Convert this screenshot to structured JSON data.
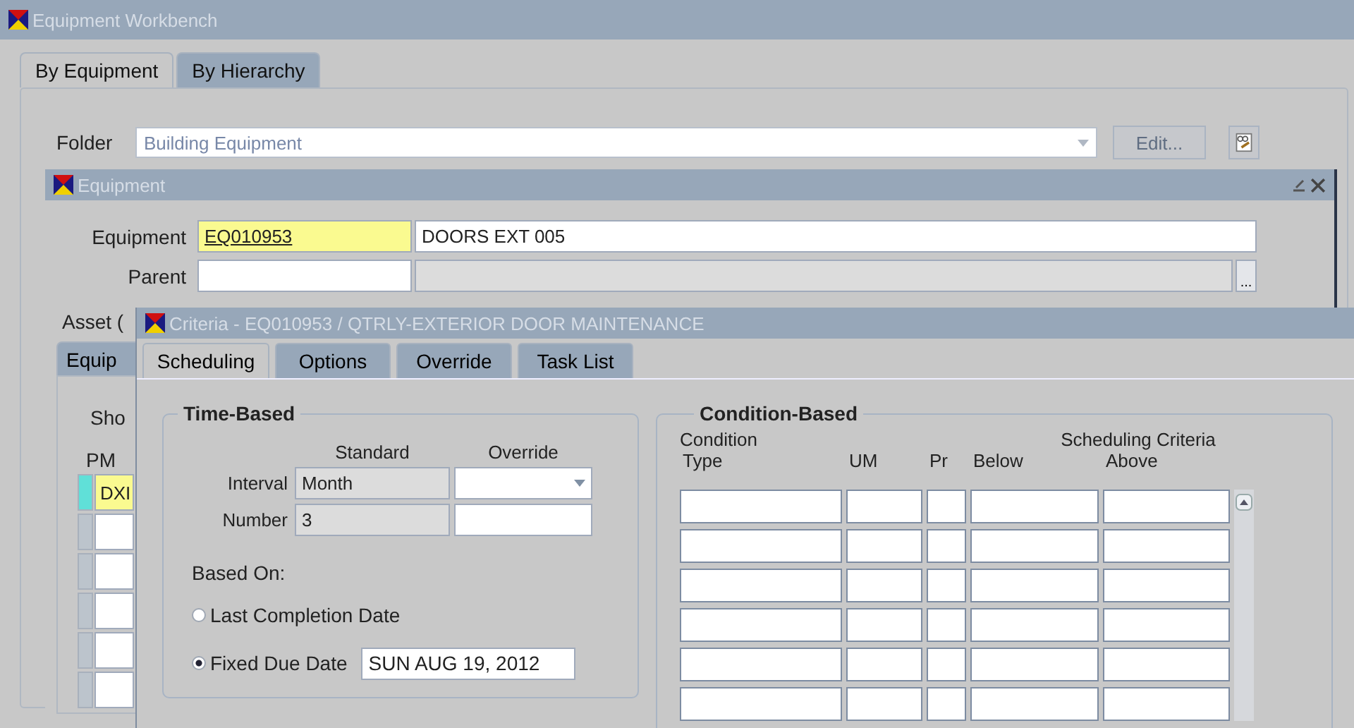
{
  "window": {
    "title": "Equipment Workbench"
  },
  "tabs": [
    {
      "label": "By Equipment",
      "selected": true
    },
    {
      "label": "By Hierarchy",
      "selected": false
    }
  ],
  "folder": {
    "label": "Folder",
    "value": "Building Equipment",
    "edit_button": "Edit..."
  },
  "equipment_window": {
    "title": "Equipment",
    "equipment_label": "Equipment",
    "equipment": "EQ010953",
    "description": "DOORS EXT 005",
    "parent_label": "Parent",
    "lookup_button": "...",
    "asset_label": "Asset (",
    "tab": "Equip",
    "show_label": "Sho",
    "pm_label": "PM",
    "pm_rows": [
      {
        "value": "DXI",
        "selected": true
      },
      {
        "selected": false
      },
      {
        "selected": false
      },
      {
        "selected": false
      },
      {
        "selected": false
      },
      {
        "selected": false
      }
    ]
  },
  "criteria_window": {
    "title": "Criteria - EQ010953 / QTRLY-EXTERIOR DOOR MAINTENANCE",
    "tabs": [
      {
        "label": "Scheduling",
        "selected": true
      },
      {
        "label": "Options",
        "selected": false
      },
      {
        "label": "Override",
        "selected": false
      },
      {
        "label": "Task List",
        "selected": false
      }
    ],
    "time_based": {
      "title": "Time-Based",
      "columns": [
        "Standard",
        "Override"
      ],
      "interval": {
        "label": "Interval",
        "standard": "Month"
      },
      "number": {
        "label": "Number",
        "standard": "3"
      },
      "based_on_label": "Based On:",
      "options": [
        {
          "label": "Last Completion Date",
          "selected": false
        },
        {
          "label": "Fixed Due Date",
          "selected": true
        }
      ],
      "due_date": "SUN AUG 19, 2012"
    },
    "condition_based": {
      "title": "Condition-Based",
      "condition_label": "Condition",
      "group_label": "Scheduling Criteria",
      "columns": [
        "Type",
        "UM",
        "Pr",
        "Below",
        "Above"
      ]
    }
  }
}
